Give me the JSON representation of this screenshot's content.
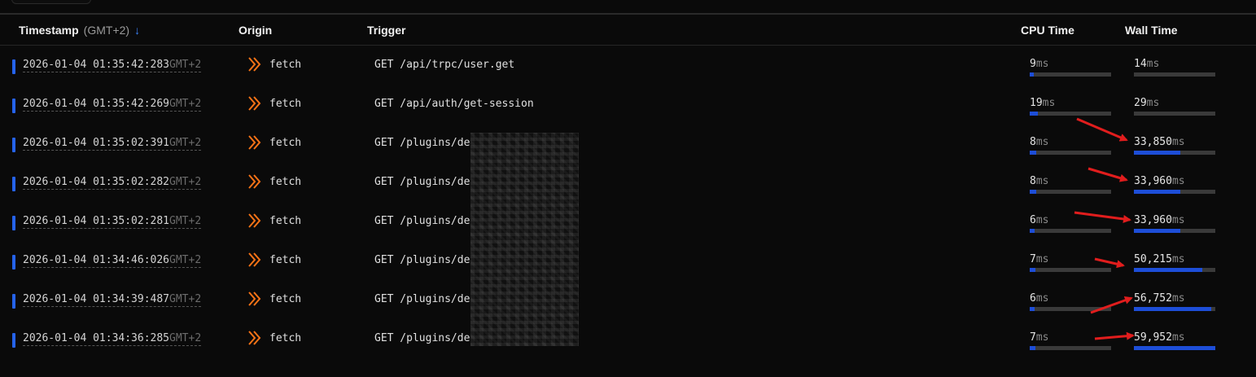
{
  "header": {
    "timestamp_label": "Timestamp",
    "timezone": "(GMT+2)",
    "sort_icon": "arrow-down",
    "origin_label": "Origin",
    "trigger_label": "Trigger",
    "cpu_label": "CPU Time",
    "wall_label": "Wall Time"
  },
  "colors": {
    "background": "#0a0a0a",
    "accent": "#2563eb",
    "origin_icon": "#f97316",
    "annotation_arrow": "#e11d1d"
  },
  "unit": "ms",
  "rows": [
    {
      "timestamp": "2026-01-04 01:35:42:283",
      "tz": "GMT+2",
      "origin": "fetch",
      "trigger": "GET /api/trpc/user.get",
      "cpu": "9",
      "wall": "14",
      "cpu_fraction": 0.05,
      "wall_fraction": 0.0
    },
    {
      "timestamp": "2026-01-04 01:35:42:269",
      "tz": "GMT+2",
      "origin": "fetch",
      "trigger": "GET /api/auth/get-session",
      "cpu": "19",
      "wall": "29",
      "cpu_fraction": 0.1,
      "wall_fraction": 0.0
    },
    {
      "timestamp": "2026-01-04 01:35:02:391",
      "tz": "GMT+2",
      "origin": "fetch",
      "trigger": "GET /plugins/de",
      "cpu": "8",
      "wall": "33,850",
      "cpu_fraction": 0.08,
      "wall_fraction": 0.57
    },
    {
      "timestamp": "2026-01-04 01:35:02:282",
      "tz": "GMT+2",
      "origin": "fetch",
      "trigger": "GET /plugins/de",
      "cpu": "8",
      "wall": "33,960",
      "cpu_fraction": 0.08,
      "wall_fraction": 0.57
    },
    {
      "timestamp": "2026-01-04 01:35:02:281",
      "tz": "GMT+2",
      "origin": "fetch",
      "trigger": "GET /plugins/de",
      "cpu": "6",
      "wall": "33,960",
      "cpu_fraction": 0.06,
      "wall_fraction": 0.57
    },
    {
      "timestamp": "2026-01-04 01:34:46:026",
      "tz": "GMT+2",
      "origin": "fetch",
      "trigger": "GET /plugins/de",
      "cpu": "7",
      "wall": "50,215",
      "cpu_fraction": 0.07,
      "wall_fraction": 0.84
    },
    {
      "timestamp": "2026-01-04 01:34:39:487",
      "tz": "GMT+2",
      "origin": "fetch",
      "trigger": "GET /plugins/de",
      "cpu": "6",
      "wall": "56,752",
      "cpu_fraction": 0.06,
      "wall_fraction": 0.95
    },
    {
      "timestamp": "2026-01-04 01:34:36:285",
      "tz": "GMT+2",
      "origin": "fetch",
      "trigger": "GET /plugins/de",
      "cpu": "7",
      "wall": "59,952",
      "cpu_fraction": 0.07,
      "wall_fraction": 1.0
    }
  ]
}
